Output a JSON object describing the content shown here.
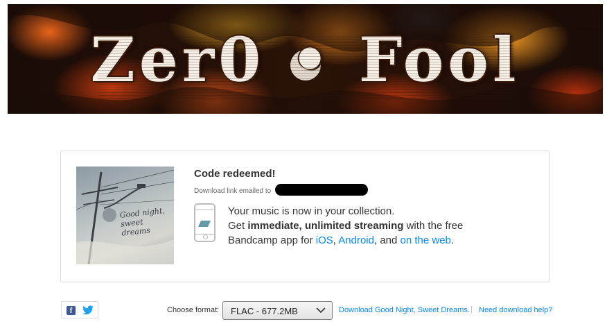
{
  "banner": {
    "title": "Zer0 • Fool"
  },
  "card": {
    "cover_text": "Good night, sweet dreams",
    "heading": "Code redeemed!",
    "emailed_label": "Download link emailed to",
    "message": {
      "line1": "Your music is now in your collection.",
      "get": "Get ",
      "bold": "immediate, unlimited streaming",
      "with_free": " with the free",
      "app_for": "Bandcamp app for ",
      "ios": "iOS",
      "comma": ", ",
      "android": "Android",
      "and": ", and ",
      "web": "on the web",
      "period": "."
    }
  },
  "bottom": {
    "choose_format_label": "Choose format:",
    "format_value": "FLAC - 677.2MB",
    "download_link": "Download Good Night, Sweet Dreams.",
    "separator": "|",
    "help_link": "Need download help?"
  },
  "icons": [
    "facebook-icon",
    "twitter-icon",
    "chevron-down-icon",
    "phone-icon"
  ],
  "colors": {
    "link": "#0687f5",
    "facebook": "#3b5998",
    "twitter": "#1da1f2",
    "app_logo": "#629aa9"
  }
}
